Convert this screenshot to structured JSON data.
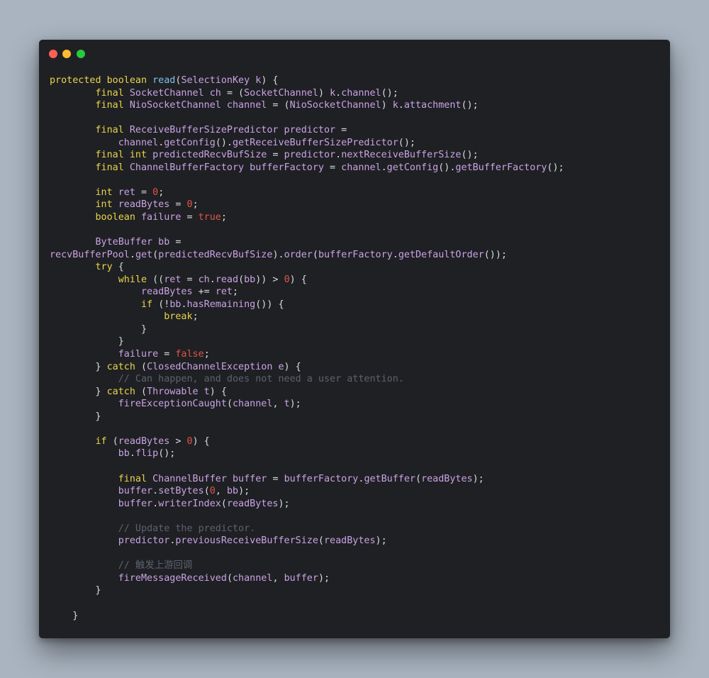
{
  "window": {
    "controls": {
      "close_color": "#ff5f57",
      "minimize_color": "#febc2e",
      "maximize_color": "#28c840"
    }
  },
  "editor": {
    "language": "java",
    "colors": {
      "background": "#1f2023",
      "keyword": "#e8d44d",
      "function": "#7ec4e8",
      "identifier": "#c9a3e6",
      "number": "#e0534a",
      "comment": "#5c6270",
      "punctuation": "#d8dade"
    },
    "lines": [
      [
        [
          "kw",
          "protected boolean "
        ],
        [
          "fn",
          "read"
        ],
        [
          "p",
          "("
        ],
        [
          "id",
          "SelectionKey k"
        ],
        [
          "p",
          ") {"
        ]
      ],
      [
        [
          "p",
          "        "
        ],
        [
          "kw",
          "final "
        ],
        [
          "id",
          "SocketChannel ch "
        ],
        [
          "p",
          "= ("
        ],
        [
          "id",
          "SocketChannel"
        ],
        [
          "p",
          ") "
        ],
        [
          "id",
          "k"
        ],
        [
          "p",
          "."
        ],
        [
          "id",
          "channel"
        ],
        [
          "p",
          "();"
        ]
      ],
      [
        [
          "p",
          "        "
        ],
        [
          "kw",
          "final "
        ],
        [
          "id",
          "NioSocketChannel channel "
        ],
        [
          "p",
          "= ("
        ],
        [
          "id",
          "NioSocketChannel"
        ],
        [
          "p",
          ") "
        ],
        [
          "id",
          "k"
        ],
        [
          "p",
          "."
        ],
        [
          "id",
          "attachment"
        ],
        [
          "p",
          "();"
        ]
      ],
      [
        [
          "p",
          ""
        ]
      ],
      [
        [
          "p",
          "        "
        ],
        [
          "kw",
          "final "
        ],
        [
          "id",
          "ReceiveBufferSizePredictor predictor "
        ],
        [
          "p",
          "="
        ]
      ],
      [
        [
          "p",
          "            "
        ],
        [
          "id",
          "channel"
        ],
        [
          "p",
          "."
        ],
        [
          "id",
          "getConfig"
        ],
        [
          "p",
          "()."
        ],
        [
          "id",
          "getReceiveBufferSizePredictor"
        ],
        [
          "p",
          "();"
        ]
      ],
      [
        [
          "p",
          "        "
        ],
        [
          "kw",
          "final int "
        ],
        [
          "id",
          "predictedRecvBufSize "
        ],
        [
          "p",
          "= "
        ],
        [
          "id",
          "predictor"
        ],
        [
          "p",
          "."
        ],
        [
          "id",
          "nextReceiveBufferSize"
        ],
        [
          "p",
          "();"
        ]
      ],
      [
        [
          "p",
          "        "
        ],
        [
          "kw",
          "final "
        ],
        [
          "id",
          "ChannelBufferFactory bufferFactory "
        ],
        [
          "p",
          "= "
        ],
        [
          "id",
          "channel"
        ],
        [
          "p",
          "."
        ],
        [
          "id",
          "getConfig"
        ],
        [
          "p",
          "()."
        ],
        [
          "id",
          "getBufferFactory"
        ],
        [
          "p",
          "();"
        ]
      ],
      [
        [
          "p",
          ""
        ]
      ],
      [
        [
          "p",
          "        "
        ],
        [
          "kw",
          "int "
        ],
        [
          "id",
          "ret "
        ],
        [
          "p",
          "= "
        ],
        [
          "num",
          "0"
        ],
        [
          "p",
          ";"
        ]
      ],
      [
        [
          "p",
          "        "
        ],
        [
          "kw",
          "int "
        ],
        [
          "id",
          "readBytes "
        ],
        [
          "p",
          "= "
        ],
        [
          "num",
          "0"
        ],
        [
          "p",
          ";"
        ]
      ],
      [
        [
          "p",
          "        "
        ],
        [
          "kw",
          "boolean "
        ],
        [
          "id",
          "failure "
        ],
        [
          "p",
          "= "
        ],
        [
          "num",
          "true"
        ],
        [
          "p",
          ";"
        ]
      ],
      [
        [
          "p",
          ""
        ]
      ],
      [
        [
          "p",
          "        "
        ],
        [
          "id",
          "ByteBuffer bb "
        ],
        [
          "p",
          "="
        ]
      ],
      [
        [
          "id",
          "recvBufferPool"
        ],
        [
          "p",
          "."
        ],
        [
          "id",
          "get"
        ],
        [
          "p",
          "("
        ],
        [
          "id",
          "predictedRecvBufSize"
        ],
        [
          "p",
          ")."
        ],
        [
          "id",
          "order"
        ],
        [
          "p",
          "("
        ],
        [
          "id",
          "bufferFactory"
        ],
        [
          "p",
          "."
        ],
        [
          "id",
          "getDefaultOrder"
        ],
        [
          "p",
          "());"
        ]
      ],
      [
        [
          "p",
          "        "
        ],
        [
          "kw",
          "try "
        ],
        [
          "p",
          "{"
        ]
      ],
      [
        [
          "p",
          "            "
        ],
        [
          "kw",
          "while "
        ],
        [
          "p",
          "(("
        ],
        [
          "id",
          "ret "
        ],
        [
          "p",
          "= "
        ],
        [
          "id",
          "ch"
        ],
        [
          "p",
          "."
        ],
        [
          "id",
          "read"
        ],
        [
          "p",
          "("
        ],
        [
          "id",
          "bb"
        ],
        [
          "p",
          ")) > "
        ],
        [
          "num",
          "0"
        ],
        [
          "p",
          ") {"
        ]
      ],
      [
        [
          "p",
          "                "
        ],
        [
          "id",
          "readBytes "
        ],
        [
          "p",
          "+= "
        ],
        [
          "id",
          "ret"
        ],
        [
          "p",
          ";"
        ]
      ],
      [
        [
          "p",
          "                "
        ],
        [
          "kw",
          "if "
        ],
        [
          "p",
          "(!"
        ],
        [
          "id",
          "bb"
        ],
        [
          "p",
          "."
        ],
        [
          "id",
          "hasRemaining"
        ],
        [
          "p",
          "()) {"
        ]
      ],
      [
        [
          "p",
          "                    "
        ],
        [
          "kw",
          "break"
        ],
        [
          "p",
          ";"
        ]
      ],
      [
        [
          "p",
          "                }"
        ]
      ],
      [
        [
          "p",
          "            }"
        ]
      ],
      [
        [
          "p",
          "            "
        ],
        [
          "id",
          "failure "
        ],
        [
          "p",
          "= "
        ],
        [
          "num",
          "false"
        ],
        [
          "p",
          ";"
        ]
      ],
      [
        [
          "p",
          "        } "
        ],
        [
          "kw",
          "catch "
        ],
        [
          "p",
          "("
        ],
        [
          "id",
          "ClosedChannelException e"
        ],
        [
          "p",
          ") {"
        ]
      ],
      [
        [
          "p",
          "            "
        ],
        [
          "cmt",
          "// Can happen, and does not need a user attention."
        ]
      ],
      [
        [
          "p",
          "        } "
        ],
        [
          "kw",
          "catch "
        ],
        [
          "p",
          "("
        ],
        [
          "id",
          "Throwable t"
        ],
        [
          "p",
          ") {"
        ]
      ],
      [
        [
          "p",
          "            "
        ],
        [
          "id",
          "fireExceptionCaught"
        ],
        [
          "p",
          "("
        ],
        [
          "id",
          "channel"
        ],
        [
          "p",
          ", "
        ],
        [
          "id",
          "t"
        ],
        [
          "p",
          ");"
        ]
      ],
      [
        [
          "p",
          "        }"
        ]
      ],
      [
        [
          "p",
          ""
        ]
      ],
      [
        [
          "p",
          "        "
        ],
        [
          "kw",
          "if "
        ],
        [
          "p",
          "("
        ],
        [
          "id",
          "readBytes "
        ],
        [
          "p",
          "> "
        ],
        [
          "num",
          "0"
        ],
        [
          "p",
          ") {"
        ]
      ],
      [
        [
          "p",
          "            "
        ],
        [
          "id",
          "bb"
        ],
        [
          "p",
          "."
        ],
        [
          "id",
          "flip"
        ],
        [
          "p",
          "();"
        ]
      ],
      [
        [
          "p",
          ""
        ]
      ],
      [
        [
          "p",
          "            "
        ],
        [
          "kw",
          "final "
        ],
        [
          "id",
          "ChannelBuffer buffer "
        ],
        [
          "p",
          "= "
        ],
        [
          "id",
          "bufferFactory"
        ],
        [
          "p",
          "."
        ],
        [
          "id",
          "getBuffer"
        ],
        [
          "p",
          "("
        ],
        [
          "id",
          "readBytes"
        ],
        [
          "p",
          ");"
        ]
      ],
      [
        [
          "p",
          "            "
        ],
        [
          "id",
          "buffer"
        ],
        [
          "p",
          "."
        ],
        [
          "id",
          "setBytes"
        ],
        [
          "p",
          "("
        ],
        [
          "num",
          "0"
        ],
        [
          "p",
          ", "
        ],
        [
          "id",
          "bb"
        ],
        [
          "p",
          ");"
        ]
      ],
      [
        [
          "p",
          "            "
        ],
        [
          "id",
          "buffer"
        ],
        [
          "p",
          "."
        ],
        [
          "id",
          "writerIndex"
        ],
        [
          "p",
          "("
        ],
        [
          "id",
          "readBytes"
        ],
        [
          "p",
          ");"
        ]
      ],
      [
        [
          "p",
          ""
        ]
      ],
      [
        [
          "p",
          "            "
        ],
        [
          "cmt",
          "// Update the predictor."
        ]
      ],
      [
        [
          "p",
          "            "
        ],
        [
          "id",
          "predictor"
        ],
        [
          "p",
          "."
        ],
        [
          "id",
          "previousReceiveBufferSize"
        ],
        [
          "p",
          "("
        ],
        [
          "id",
          "readBytes"
        ],
        [
          "p",
          ");"
        ]
      ],
      [
        [
          "p",
          ""
        ]
      ],
      [
        [
          "p",
          "            "
        ],
        [
          "cmt",
          "// 触发上游回调"
        ]
      ],
      [
        [
          "p",
          "            "
        ],
        [
          "id",
          "fireMessageReceived"
        ],
        [
          "p",
          "("
        ],
        [
          "id",
          "channel"
        ],
        [
          "p",
          ", "
        ],
        [
          "id",
          "buffer"
        ],
        [
          "p",
          ");"
        ]
      ],
      [
        [
          "p",
          "        }"
        ]
      ],
      [
        [
          "p",
          ""
        ]
      ],
      [
        [
          "p",
          "    }"
        ]
      ]
    ]
  }
}
